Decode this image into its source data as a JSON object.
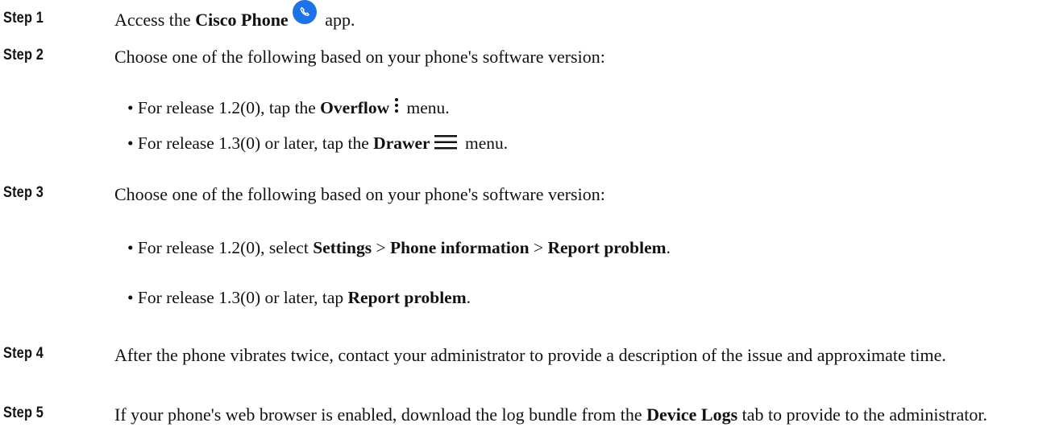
{
  "steps": [
    {
      "label": "Step 1",
      "text": {
        "a": "Access the ",
        "b": "Cisco Phone",
        "c": " app."
      }
    },
    {
      "label": "Step 2",
      "text": "Choose one of the following based on your phone's software version:",
      "bullets": [
        {
          "a": "• For release 1.2(0), tap the ",
          "b": "Overflow",
          "c": " menu."
        },
        {
          "a": "• For release 1.3(0) or later, tap the ",
          "b": "Drawer",
          "c": " menu."
        }
      ]
    },
    {
      "label": "Step 3",
      "text": "Choose one of the following based on your phone's software version:",
      "bullets": [
        {
          "a": "• For release 1.2(0), select ",
          "b1": "Settings",
          "s1": " > ",
          "b2": "Phone information",
          "s2": " > ",
          "b3": "Report problem",
          "end": "."
        },
        {
          "a": "• For release 1.3(0) or later, tap ",
          "b": "Report problem",
          "c": "."
        }
      ]
    },
    {
      "label": "Step 4",
      "text": "After the phone vibrates twice, contact your administrator to provide a description of the issue and approximate time."
    },
    {
      "label": "Step 5",
      "text": {
        "a": "If your phone's web browser is enabled, download the log bundle from the ",
        "b": "Device Logs",
        "c": " tab to provide to the administrator."
      }
    }
  ],
  "icons": {
    "phone": "phone-app-icon",
    "overflow": "overflow-menu-icon",
    "drawer": "drawer-menu-icon",
    "phone_color": "#1d72e8"
  }
}
